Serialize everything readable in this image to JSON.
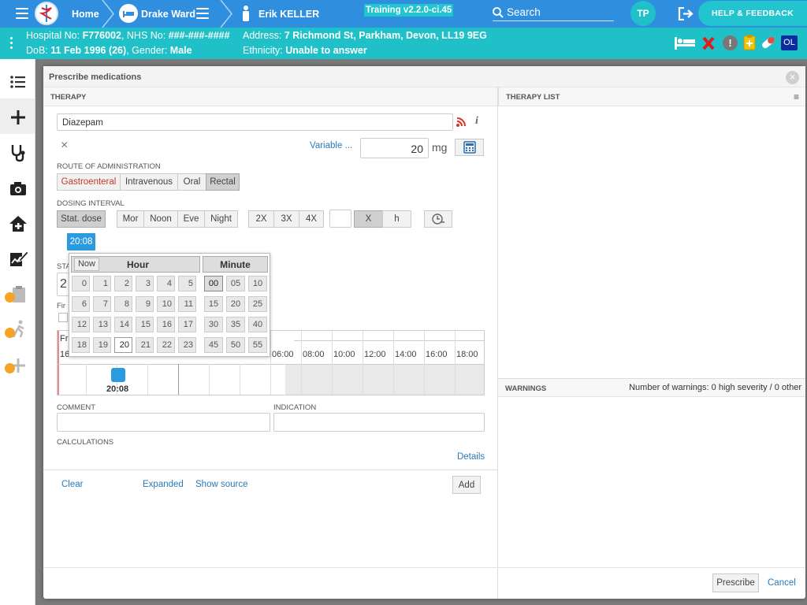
{
  "topbar": {
    "home": "Home",
    "ward": "Drake Ward",
    "patient_name": "Erik KELLER",
    "training_badge": "Training v2.2.0-ci.45",
    "search_placeholder": "Search",
    "user_initials": "TP",
    "help_label": "HELP & FEEDBACK"
  },
  "patient": {
    "hospital_label": "Hospital No:",
    "hospital_no": "F776002",
    "nhs_label": "NHS No:",
    "nhs_no": "###-###-####",
    "address_label": "Address:",
    "address": "7 Richmond St, Parkham, Devon, LL19 9EG",
    "dob_label": "DoB:",
    "dob": "11 Feb 1996 (26)",
    "gender_label": "Gender:",
    "gender": "Male",
    "ethnicity_label": "Ethnicity:",
    "ethnicity": "Unable to answer",
    "badge_ol": "OL"
  },
  "modal": {
    "title": "Prescribe medications",
    "therapy_header": "THERAPY",
    "therapy_list_header": "THERAPY LIST",
    "warnings_header": "WARNINGS",
    "warnings_count": "Number of warnings: 0 high severity / 0 other",
    "medication": "Diazepam",
    "variable_link": "Variable ...",
    "dose_value": "20",
    "dose_unit": "mg",
    "route_label": "ROUTE OF ADMINISTRATION",
    "routes": [
      "Gastroenteral",
      "Intravenous",
      "Oral",
      "Rectal"
    ],
    "dosing_label": "DOSING INTERVAL",
    "stat_dose": "Stat. dose",
    "times_of_day": [
      "Mor",
      "Noon",
      "Eve",
      "Night"
    ],
    "frequencies": [
      "2X",
      "3X",
      "4X"
    ],
    "x_label": "X",
    "h_label": "h",
    "start_partial": "STA",
    "start_value_partial": "2",
    "first_partial": "Fir",
    "timeline_partial_fr": "Fr",
    "timeline_partial_16": "16",
    "tooltip_time": "20:08",
    "marker_time": "20:08",
    "timeline_ticks": [
      "06:00",
      "08:00",
      "10:00",
      "12:00",
      "14:00",
      "16:00",
      "18:00"
    ],
    "comment_label": "COMMENT",
    "indication_label": "INDICATION",
    "calculations_label": "CALCULATIONS",
    "details_link": "Details",
    "clear_link": "Clear",
    "expanded_link": "Expanded",
    "show_source_link": "Show source",
    "add_button": "Add",
    "prescribe_button": "Prescribe",
    "cancel_link": "Cancel"
  },
  "picker": {
    "now": "Now",
    "hour_header": "Hour",
    "minute_header": "Minute",
    "hours": [
      "0",
      "1",
      "2",
      "3",
      "4",
      "5",
      "6",
      "7",
      "8",
      "9",
      "10",
      "11",
      "12",
      "13",
      "14",
      "15",
      "16",
      "17",
      "18",
      "19",
      "20",
      "21",
      "22",
      "23"
    ],
    "minutes": [
      "00",
      "05",
      "10",
      "15",
      "20",
      "25",
      "30",
      "35",
      "40",
      "45",
      "50",
      "55"
    ],
    "selected_hour": "20",
    "selected_minute": "00"
  },
  "sidebar_icons": [
    "list-icon",
    "plus-icon",
    "stethoscope-icon",
    "camera-icon",
    "home-plus-icon",
    "edit-chart-icon",
    "locked-clipboard-icon",
    "locked-walk-icon",
    "locked-plus-icon"
  ]
}
